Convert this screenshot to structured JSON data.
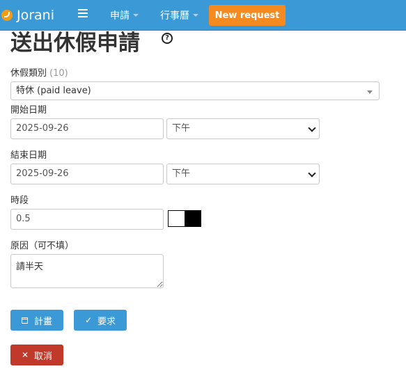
{
  "navbar": {
    "brand": "Jorani",
    "menus": [
      "申請",
      "行事曆"
    ],
    "new_request": "New request"
  },
  "page": {
    "title": "送出休假申請",
    "help_icon": "?"
  },
  "form": {
    "leave_type_label": "休假類別",
    "leave_type_count": "(10)",
    "leave_type_value": "特休 (paid leave)",
    "start_label": "開始日期",
    "start_date": "2025-09-26",
    "start_period": "下午",
    "end_label": "結束日期",
    "end_date": "2025-09-26",
    "end_period": "下午",
    "duration_label": "時段",
    "duration_value": "0.5",
    "reason_label": "原因（可不填）",
    "reason_value": "請半天"
  },
  "buttons": {
    "plan": "計畫",
    "request": "要求",
    "cancel": "取消"
  },
  "colors": {
    "navbar": "#3b99d6",
    "new_request": "#f58a20",
    "primary": "#3b99d6",
    "danger": "#c0392b"
  }
}
